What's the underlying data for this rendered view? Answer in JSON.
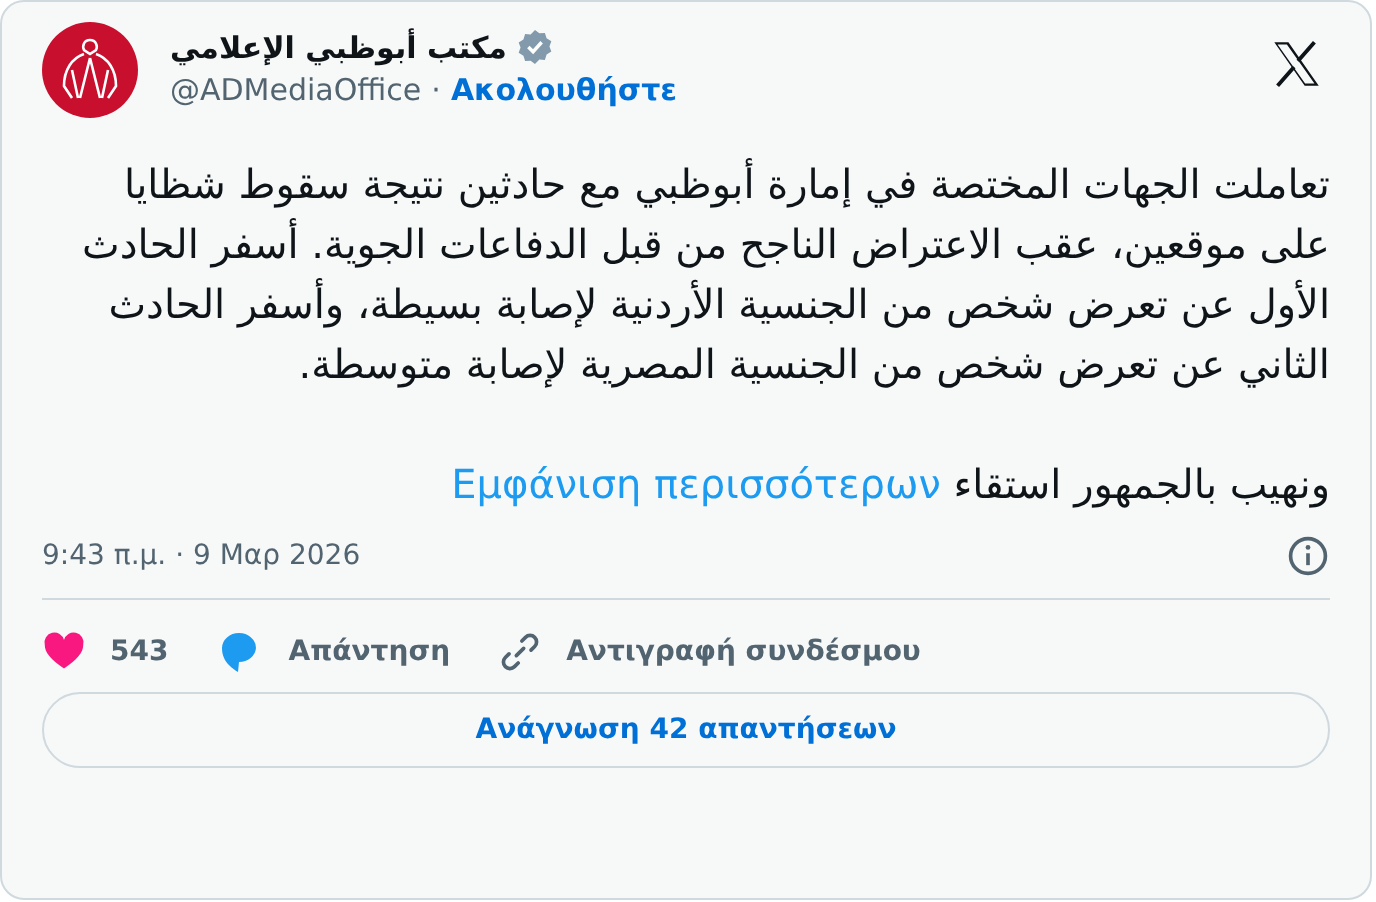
{
  "author": {
    "name": "مكتب أبوظبي الإعلامي",
    "verified": true,
    "handle": "@ADMediaOffice",
    "separator": "·",
    "follow": "Ακολουθήστε"
  },
  "body": {
    "paragraph_1": "تعاملت الجهات المختصة في إمارة أبوظبي مع حادثين نتيجة سقوط شظايا على موقعين، عقب الاعتراض الناجح من قبل الدفاعات الجوية. أسفر الحادث الأول عن تعرض شخص من الجنسية الأردنية لإصابة بسيطة، وأسفر الحادث الثاني عن تعرض شخص من الجنسية المصرية لإصابة متوسطة.",
    "paragraph_2": "ونهيب بالجمهور استقاء",
    "show_more": "Εμφάνιση περισσότερων"
  },
  "timestamp": "9:43 π.μ. · 9 Μαρ 2026",
  "like_count": "543",
  "reply_label": "Απάντηση",
  "copy_link_label": "Αντιγραφή συνδέσμου",
  "read_replies": "Ανάγνωση 42 απαντήσεων"
}
